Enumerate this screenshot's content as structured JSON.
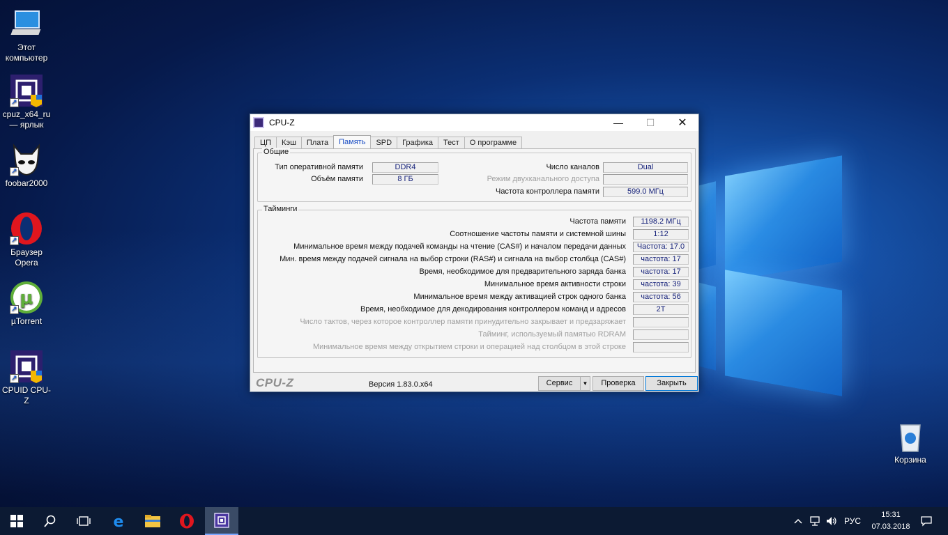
{
  "desktop": {
    "icons": [
      {
        "label": "Этот компьютер",
        "icon": "this-pc-icon"
      },
      {
        "label": "cpuz_x64_ru — ярлык",
        "icon": "cpuz-icon"
      },
      {
        "label": "foobar2000",
        "icon": "foobar-icon"
      },
      {
        "label": "Браузер Opera",
        "icon": "opera-icon"
      },
      {
        "label": "µTorrent",
        "icon": "utorrent-icon"
      },
      {
        "label": "CPUID CPU-Z",
        "icon": "cpuz-icon"
      },
      {
        "label": "Корзина",
        "icon": "recycle-bin-icon"
      }
    ]
  },
  "window": {
    "title": "CPU-Z",
    "tabs": [
      "ЦП",
      "Кэш",
      "Плата",
      "Память",
      "SPD",
      "Графика",
      "Тест",
      "О программе"
    ],
    "active_tab": "Память",
    "general": {
      "legend": "Общие",
      "type_label": "Тип оперативной памяти",
      "type_value": "DDR4",
      "size_label": "Объём памяти",
      "size_value": "8 ГБ",
      "channels_label": "Число каналов",
      "channels_value": "Dual",
      "dc_mode_label": "Режим двухканального доступа",
      "dc_mode_value": "",
      "nb_freq_label": "Частота контроллера памяти",
      "nb_freq_value": "599.0 МГц"
    },
    "timings": {
      "legend": "Тайминги",
      "rows": [
        {
          "label": "Частота памяти",
          "value": "1198.2 МГц",
          "enabled": true
        },
        {
          "label": "Соотношение частоты памяти и системной шины",
          "value": "1:12",
          "enabled": true
        },
        {
          "label": "Минимальное время между подачей команды на чтение (CAS#) и началом передачи данных",
          "value": "Частота: 17.0",
          "enabled": true
        },
        {
          "label": "Мин. время между подачей сигнала на выбор строки (RAS#) и сигнала на выбор столбца (CAS#)",
          "value": "частота: 17",
          "enabled": true
        },
        {
          "label": "Время, необходимое для предварительного заряда банка",
          "value": "частота: 17",
          "enabled": true
        },
        {
          "label": "Минимальное время активности строки",
          "value": "частота: 39",
          "enabled": true
        },
        {
          "label": "Минимальное время между активацией строк одного банка",
          "value": "частота: 56",
          "enabled": true
        },
        {
          "label": "Время, необходимое для декодирования контроллером команд и адресов",
          "value": "2T",
          "enabled": true
        },
        {
          "label": "Число тактов, через которое контроллер памяти принудительно закрывает и предзаряжает",
          "value": "",
          "enabled": false
        },
        {
          "label": "Тайминг, используемый памятью RDRAM",
          "value": "",
          "enabled": false
        },
        {
          "label": "Минимальное время между открытием строки и операцией над столбцом в этой строке",
          "value": "",
          "enabled": false
        }
      ]
    },
    "footer": {
      "brand": "CPU-Z",
      "version": "Версия 1.83.0.x64",
      "service_label": "Сервис",
      "check_label": "Проверка",
      "close_label": "Закрыть"
    }
  },
  "taskbar": {
    "language": "РУС",
    "time": "15:31",
    "date": "07.03.2018"
  },
  "colors": {
    "value_text": "#16227a",
    "active_tab_text": "#1c4fc4",
    "taskbar": "#0c1a33"
  }
}
